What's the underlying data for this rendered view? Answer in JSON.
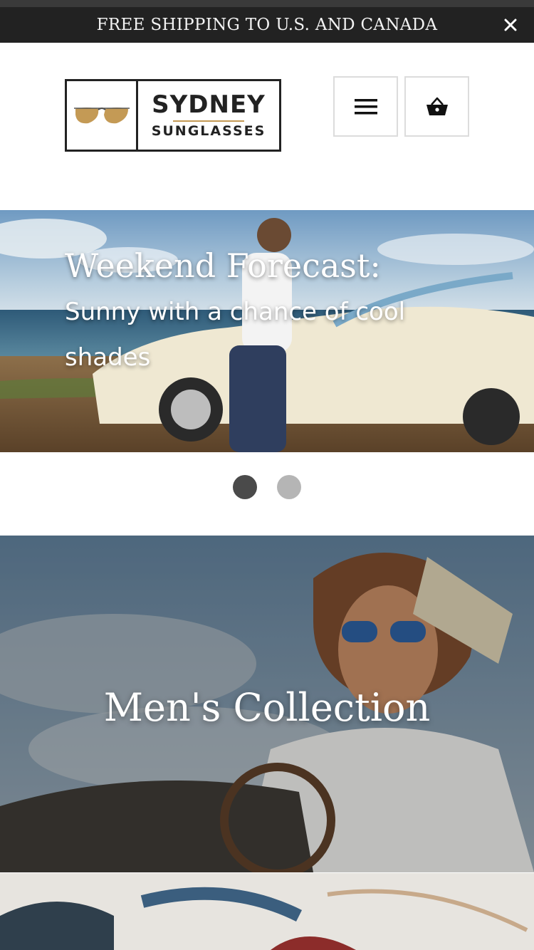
{
  "announcement": {
    "text": "FREE SHIPPING TO U.S. AND CANADA",
    "close_icon": "close-icon"
  },
  "logo": {
    "line1": "SYDNEY",
    "line2": "SUNGLASSES",
    "icon": "sunglasses-icon",
    "accent_color": "#c49a55"
  },
  "header": {
    "menu_icon": "hamburger-menu-icon",
    "cart_icon": "shopping-basket-icon"
  },
  "slideshow": {
    "title": "Weekend Forecast:",
    "subtitle": "Sunny with a chance of cool shades",
    "slides_total": 2,
    "active_slide": 1
  },
  "collections": [
    {
      "title": "Men's Collection"
    }
  ],
  "colors": {
    "announcement_bg": "#222222",
    "dot_active": "#4a4a4a",
    "dot_inactive": "#b5b5b5"
  }
}
